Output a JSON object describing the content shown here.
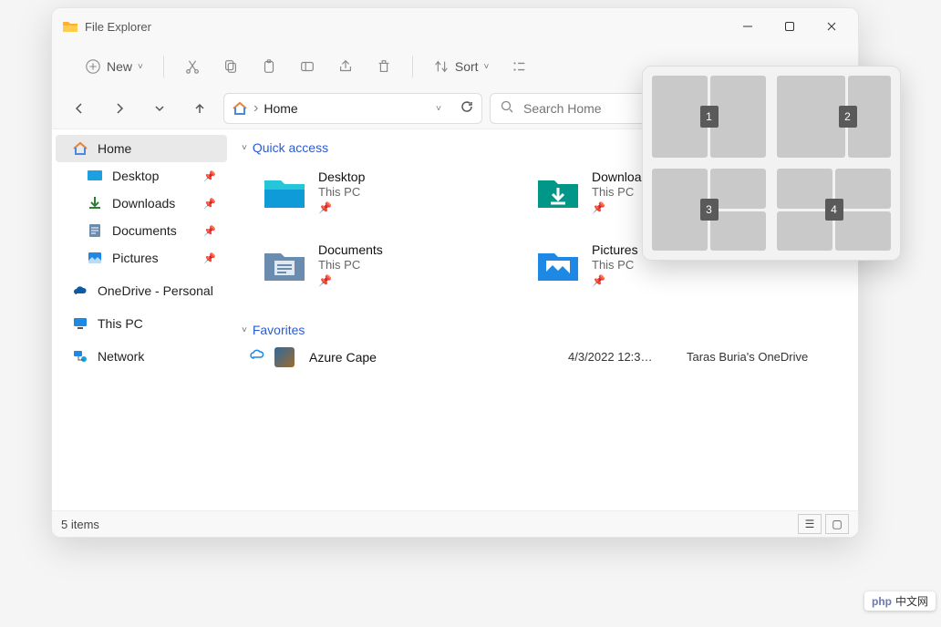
{
  "window": {
    "title": "File Explorer"
  },
  "toolbar": {
    "new_label": "New",
    "sort_label": "Sort"
  },
  "address": {
    "crumb": "Home",
    "search_placeholder": "Search Home"
  },
  "sidebar": {
    "home": "Home",
    "desktop": "Desktop",
    "downloads": "Downloads",
    "documents": "Documents",
    "pictures": "Pictures",
    "onedrive": "OneDrive - Personal",
    "thispc": "This PC",
    "network": "Network"
  },
  "sections": {
    "quick": "Quick access",
    "favorites": "Favorites"
  },
  "tiles": {
    "desktop": {
      "name": "Desktop",
      "loc": "This PC"
    },
    "downloads": {
      "name": "Downloads",
      "loc": "This PC"
    },
    "documents": {
      "name": "Documents",
      "loc": "This PC"
    },
    "pictures": {
      "name": "Pictures",
      "loc": "This PC"
    }
  },
  "favorites": {
    "item1": {
      "name": "Azure Cape",
      "date": "4/3/2022 12:3…",
      "loc": "Taras Buria's OneDrive"
    }
  },
  "status": {
    "count": "5 items"
  },
  "snap": {
    "n1": "1",
    "n2": "2",
    "n3": "3",
    "n4": "4"
  },
  "watermark": {
    "brand": "php",
    "text": "中文网"
  }
}
